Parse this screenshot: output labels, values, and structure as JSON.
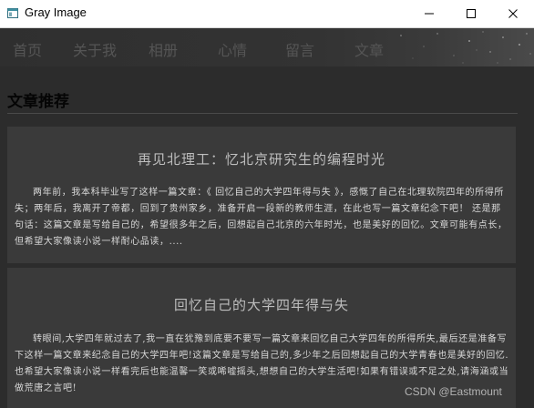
{
  "window": {
    "title": "Gray Image"
  },
  "nav": {
    "items": [
      {
        "label": "首页"
      },
      {
        "label": "关于我"
      },
      {
        "label": "相册"
      },
      {
        "label": "心情"
      },
      {
        "label": "留言"
      },
      {
        "label": "文章"
      }
    ]
  },
  "section": {
    "title": "文章推荐"
  },
  "articles": [
    {
      "title": "再见北理工：忆北京研究生的编程时光",
      "summary": "两年前，我本科毕业写了这样一篇文章：《 回忆自己的大学四年得与失 》，感慨了自己在北理软院四年的所得所失；两年后，我离开了帝都，回到了贵州家乡，准备开启一段新的教师生涯，在此也写一篇文章纪念下吧！ 还是那句话：这篇文章是写给自己的，希望很多年之后，回想起自己北京的六年时光，也是美好的回忆。文章可能有点长，但希望大家像读小说一样耐心品读，...."
    },
    {
      "title": "回忆自己的大学四年得与失",
      "summary": "转眼间,大学四年就过去了,我一直在犹豫到底要不要写一篇文章来回忆自己大学四年的所得所失,最后还是准备写下这样一篇文章来纪念自己的大学四年吧!这篇文章是写给自己的,多少年之后回想起自己的大学青春也是美好的回忆.也希望大家像读小说一样看完后也能温馨一笑或唏嘘摇头,想想自己的大学生活吧!如果有错误或不足之处,请海涵或当做荒唐之言吧!"
    }
  ],
  "watermark": {
    "text": "CSDN @Eastmount"
  }
}
